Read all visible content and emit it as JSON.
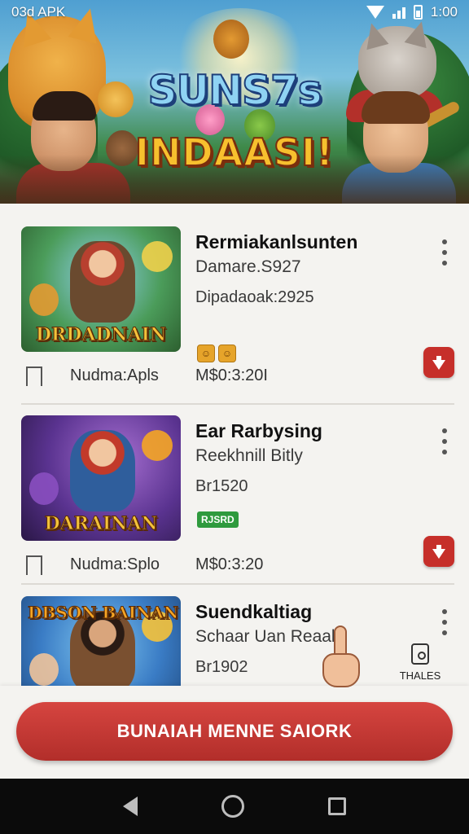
{
  "status_bar": {
    "left_text": "03d APK",
    "time": "1:00"
  },
  "hero": {
    "title": "SUNS7s",
    "subtitle": "INDAASI!"
  },
  "apps": [
    {
      "thumb_logo": "DRDADNAIN",
      "title": "Rermiakanlsunten",
      "line1": "Damare.S927",
      "line2": "Dipadaoak:2925",
      "meta_left": "Nudma:Apls",
      "meta_right": "M$0:3:20I"
    },
    {
      "thumb_logo": "DARAINAN",
      "title": "Ear Rarbysing",
      "line1": "Reekhnill Bitly",
      "line2": "Br1520",
      "badge": "RJSRD",
      "meta_left": "Nudma:Splo",
      "meta_right": "M$0:3:20"
    },
    {
      "thumb_logo": "DBSON BAINAN",
      "title": "Suendkaltiag",
      "line1": "Schaar Uan Reaak",
      "line2": "Br1902"
    }
  ],
  "share_label": "THALES",
  "cta_label": "BUNAIAH MENNE SAIORK",
  "colors": {
    "accent": "#c62f2a",
    "badge_green": "#2f9a3e"
  }
}
